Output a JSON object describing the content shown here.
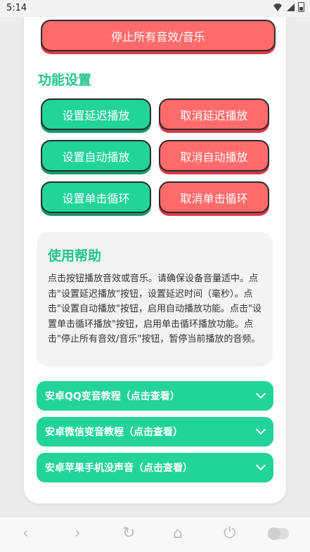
{
  "status": {
    "time": "5:14"
  },
  "buttons": {
    "stop_all": "停止所有音效/音乐",
    "set_delay": "设置延迟播放",
    "cancel_delay": "取消延迟播放",
    "set_auto": "设置自动播放",
    "cancel_auto": "取消自动播放",
    "set_loop": "设置单击循环",
    "cancel_loop": "取消单击循环"
  },
  "section_title": "功能设置",
  "help": {
    "title": "使用帮助",
    "text": "点击按钮播放音效或音乐。请确保设备音量适中。点击\"设置延迟播放\"按钮，设置延迟时间（毫秒）。点击\"设置自动播放\"按钮，启用自动播放功能。点击\"设置单击循环播放\"按钮，启用单击循环播放功能。点击\"停止所有音效/音乐\"按钮，暂停当前播放的音频。"
  },
  "tutorials": [
    "安卓QQ变音教程（点击查看）",
    "安卓微信变音教程（点击查看）",
    "安卓苹果手机没声音（点击查看）"
  ],
  "navbar_icons": [
    "back-icon",
    "forward-icon",
    "refresh-icon",
    "home-icon",
    "power-icon",
    "toggle"
  ],
  "colors": {
    "accent_green": "#22d39a",
    "accent_red": "#ff6b6b",
    "title_green": "#22c38e"
  }
}
